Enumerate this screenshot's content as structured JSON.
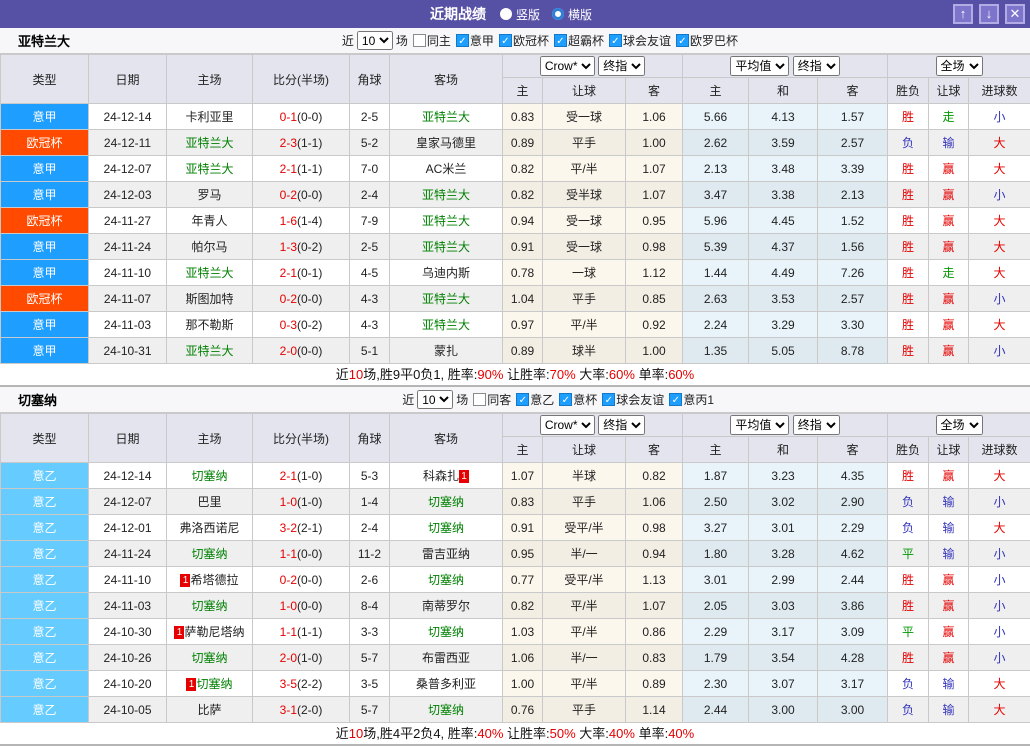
{
  "titlebar": {
    "title": "近期战绩",
    "radio_vertical_label": "竖版",
    "radio_horizontal_label": "横版",
    "up_icon": "↑",
    "down_icon": "↓",
    "close_icon": "✕"
  },
  "filters": {
    "near_label": "近",
    "near_value": "10",
    "games_label": "场"
  },
  "selects": {
    "bookmaker": "Crow*",
    "final_1": "终指",
    "average": "平均值",
    "final_2": "终指",
    "full_match": "全场"
  },
  "columns": {
    "type": "类型",
    "date": "日期",
    "home": "主场",
    "score": "比分(半场)",
    "corner": "角球",
    "away": "客场",
    "odds_home": "主",
    "odds_handicap": "让球",
    "odds_away": "客",
    "avg_home": "主",
    "avg_draw": "和",
    "avg_away": "客",
    "result": "胜负",
    "handicap_result": "让球",
    "goals": "进球数"
  },
  "league_colors": {
    "意甲": "#1e9fff",
    "欧冠杯": "#ff4a00",
    "意乙": "#66ccff"
  },
  "colors": {
    "title_bar": "#5751a5",
    "win_red": "#e60000",
    "lose_blue": "#3333bb",
    "draw_green": "#009900",
    "team_green": "#008000",
    "checkbox_blue": "#1e9fff"
  },
  "sections": [
    {
      "team": "亚特兰大",
      "same_label": "同主",
      "leagues": [
        "意甲",
        "欧冠杯",
        "超霸杯",
        "球会友谊",
        "欧罗巴杯"
      ],
      "rows": [
        {
          "lg": "意甲",
          "dt": "24-12-14",
          "hm": {
            "n": "卡利亚里"
          },
          "s": "0-1",
          "hs": "(0-0)",
          "c": "2-5",
          "aw": {
            "n": "亚特兰大",
            "t": 1
          },
          "o": [
            "0.83",
            "受一球",
            "1.06"
          ],
          "a": [
            "5.66",
            "4.13",
            "1.57"
          ],
          "w": [
            "胜",
            "r"
          ],
          "hr": [
            "走",
            "g"
          ],
          "g": [
            "小",
            "b"
          ]
        },
        {
          "lg": "欧冠杯",
          "dt": "24-12-11",
          "hm": {
            "n": "亚特兰大",
            "t": 1
          },
          "s": "2-3",
          "hs": "(1-1)",
          "c": "5-2",
          "aw": {
            "n": "皇家马德里"
          },
          "o": [
            "0.89",
            "平手",
            "1.00"
          ],
          "a": [
            "2.62",
            "3.59",
            "2.57"
          ],
          "w": [
            "负",
            "b"
          ],
          "hr": [
            "输",
            "b"
          ],
          "g": [
            "大",
            "r"
          ]
        },
        {
          "lg": "意甲",
          "dt": "24-12-07",
          "hm": {
            "n": "亚特兰大",
            "t": 1
          },
          "s": "2-1",
          "hs": "(1-1)",
          "c": "7-0",
          "aw": {
            "n": "AC米兰"
          },
          "o": [
            "0.82",
            "平/半",
            "1.07"
          ],
          "a": [
            "2.13",
            "3.48",
            "3.39"
          ],
          "w": [
            "胜",
            "r"
          ],
          "hr": [
            "赢",
            "r"
          ],
          "g": [
            "大",
            "r"
          ]
        },
        {
          "lg": "意甲",
          "dt": "24-12-03",
          "hm": {
            "n": "罗马"
          },
          "s": "0-2",
          "hs": "(0-0)",
          "c": "2-4",
          "aw": {
            "n": "亚特兰大",
            "t": 1
          },
          "o": [
            "0.82",
            "受半球",
            "1.07"
          ],
          "a": [
            "3.47",
            "3.38",
            "2.13"
          ],
          "w": [
            "胜",
            "r"
          ],
          "hr": [
            "赢",
            "r"
          ],
          "g": [
            "小",
            "b"
          ]
        },
        {
          "lg": "欧冠杯",
          "dt": "24-11-27",
          "hm": {
            "n": "年青人"
          },
          "s": "1-6",
          "hs": "(1-4)",
          "c": "7-9",
          "aw": {
            "n": "亚特兰大",
            "t": 1
          },
          "o": [
            "0.94",
            "受一球",
            "0.95"
          ],
          "a": [
            "5.96",
            "4.45",
            "1.52"
          ],
          "w": [
            "胜",
            "r"
          ],
          "hr": [
            "赢",
            "r"
          ],
          "g": [
            "大",
            "r"
          ]
        },
        {
          "lg": "意甲",
          "dt": "24-11-24",
          "hm": {
            "n": "帕尔马"
          },
          "s": "1-3",
          "hs": "(0-2)",
          "c": "2-5",
          "aw": {
            "n": "亚特兰大",
            "t": 1
          },
          "o": [
            "0.91",
            "受一球",
            "0.98"
          ],
          "a": [
            "5.39",
            "4.37",
            "1.56"
          ],
          "w": [
            "胜",
            "r"
          ],
          "hr": [
            "赢",
            "r"
          ],
          "g": [
            "大",
            "r"
          ]
        },
        {
          "lg": "意甲",
          "dt": "24-11-10",
          "hm": {
            "n": "亚特兰大",
            "t": 1
          },
          "s": "2-1",
          "hs": "(0-1)",
          "c": "4-5",
          "aw": {
            "n": "乌迪内斯"
          },
          "o": [
            "0.78",
            "一球",
            "1.12"
          ],
          "a": [
            "1.44",
            "4.49",
            "7.26"
          ],
          "w": [
            "胜",
            "r"
          ],
          "hr": [
            "走",
            "g"
          ],
          "g": [
            "大",
            "r"
          ]
        },
        {
          "lg": "欧冠杯",
          "dt": "24-11-07",
          "hm": {
            "n": "斯图加特"
          },
          "s": "0-2",
          "hs": "(0-0)",
          "c": "4-3",
          "aw": {
            "n": "亚特兰大",
            "t": 1
          },
          "o": [
            "1.04",
            "平手",
            "0.85"
          ],
          "a": [
            "2.63",
            "3.53",
            "2.57"
          ],
          "w": [
            "胜",
            "r"
          ],
          "hr": [
            "赢",
            "r"
          ],
          "g": [
            "小",
            "b"
          ]
        },
        {
          "lg": "意甲",
          "dt": "24-11-03",
          "hm": {
            "n": "那不勒斯"
          },
          "s": "0-3",
          "hs": "(0-2)",
          "c": "4-3",
          "aw": {
            "n": "亚特兰大",
            "t": 1
          },
          "o": [
            "0.97",
            "平/半",
            "0.92"
          ],
          "a": [
            "2.24",
            "3.29",
            "3.30"
          ],
          "w": [
            "胜",
            "r"
          ],
          "hr": [
            "赢",
            "r"
          ],
          "g": [
            "大",
            "r"
          ]
        },
        {
          "lg": "意甲",
          "dt": "24-10-31",
          "hm": {
            "n": "亚特兰大",
            "t": 1
          },
          "s": "2-0",
          "hs": "(0-0)",
          "c": "5-1",
          "aw": {
            "n": "蒙扎"
          },
          "o": [
            "0.89",
            "球半",
            "1.00"
          ],
          "a": [
            "1.35",
            "5.05",
            "8.78"
          ],
          "w": [
            "胜",
            "r"
          ],
          "hr": [
            "赢",
            "r"
          ],
          "g": [
            "小",
            "b"
          ]
        }
      ],
      "summary": [
        "近",
        "10",
        "场,胜9平0负1, 胜率:",
        "90%",
        " 让胜率:",
        "70%",
        " 大率:",
        "60%",
        " 单率:",
        "60%"
      ]
    },
    {
      "team": "切塞纳",
      "same_label": "同客",
      "leagues": [
        "意乙",
        "意杯",
        "球会友谊",
        "意丙1"
      ],
      "rows": [
        {
          "lg": "意乙",
          "dt": "24-12-14",
          "hm": {
            "n": "切塞纳",
            "t": 1
          },
          "s": "2-1",
          "hs": "(1-0)",
          "c": "5-3",
          "aw": {
            "n": "科森扎",
            "b": "post"
          },
          "o": [
            "1.07",
            "半球",
            "0.82"
          ],
          "a": [
            "1.87",
            "3.23",
            "4.35"
          ],
          "w": [
            "胜",
            "r"
          ],
          "hr": [
            "赢",
            "r"
          ],
          "g": [
            "大",
            "r"
          ]
        },
        {
          "lg": "意乙",
          "dt": "24-12-07",
          "hm": {
            "n": "巴里"
          },
          "s": "1-0",
          "hs": "(1-0)",
          "c": "1-4",
          "aw": {
            "n": "切塞纳",
            "t": 1
          },
          "o": [
            "0.83",
            "平手",
            "1.06"
          ],
          "a": [
            "2.50",
            "3.02",
            "2.90"
          ],
          "w": [
            "负",
            "b"
          ],
          "hr": [
            "输",
            "b"
          ],
          "g": [
            "小",
            "b"
          ]
        },
        {
          "lg": "意乙",
          "dt": "24-12-01",
          "hm": {
            "n": "弗洛西诺尼"
          },
          "s": "3-2",
          "hs": "(2-1)",
          "c": "2-4",
          "aw": {
            "n": "切塞纳",
            "t": 1
          },
          "o": [
            "0.91",
            "受平/半",
            "0.98"
          ],
          "a": [
            "3.27",
            "3.01",
            "2.29"
          ],
          "w": [
            "负",
            "b"
          ],
          "hr": [
            "输",
            "b"
          ],
          "g": [
            "大",
            "r"
          ]
        },
        {
          "lg": "意乙",
          "dt": "24-11-24",
          "hm": {
            "n": "切塞纳",
            "t": 1
          },
          "s": "1-1",
          "hs": "(0-0)",
          "c": "11-2",
          "aw": {
            "n": "雷吉亚纳"
          },
          "o": [
            "0.95",
            "半/一",
            "0.94"
          ],
          "a": [
            "1.80",
            "3.28",
            "4.62"
          ],
          "w": [
            "平",
            "g"
          ],
          "hr": [
            "输",
            "b"
          ],
          "g": [
            "小",
            "b"
          ]
        },
        {
          "lg": "意乙",
          "dt": "24-11-10",
          "hm": {
            "n": "希塔德拉",
            "b": "pre"
          },
          "s": "0-2",
          "hs": "(0-0)",
          "c": "2-6",
          "aw": {
            "n": "切塞纳",
            "t": 1
          },
          "o": [
            "0.77",
            "受平/半",
            "1.13"
          ],
          "a": [
            "3.01",
            "2.99",
            "2.44"
          ],
          "w": [
            "胜",
            "r"
          ],
          "hr": [
            "赢",
            "r"
          ],
          "g": [
            "小",
            "b"
          ]
        },
        {
          "lg": "意乙",
          "dt": "24-11-03",
          "hm": {
            "n": "切塞纳",
            "t": 1
          },
          "s": "1-0",
          "hs": "(0-0)",
          "c": "8-4",
          "aw": {
            "n": "南蒂罗尔"
          },
          "o": [
            "0.82",
            "平/半",
            "1.07"
          ],
          "a": [
            "2.05",
            "3.03",
            "3.86"
          ],
          "w": [
            "胜",
            "r"
          ],
          "hr": [
            "赢",
            "r"
          ],
          "g": [
            "小",
            "b"
          ]
        },
        {
          "lg": "意乙",
          "dt": "24-10-30",
          "hm": {
            "n": "萨勒尼塔纳",
            "b": "pre"
          },
          "s": "1-1",
          "hs": "(1-1)",
          "c": "3-3",
          "aw": {
            "n": "切塞纳",
            "t": 1
          },
          "o": [
            "1.03",
            "平/半",
            "0.86"
          ],
          "a": [
            "2.29",
            "3.17",
            "3.09"
          ],
          "w": [
            "平",
            "g"
          ],
          "hr": [
            "赢",
            "r"
          ],
          "g": [
            "小",
            "b"
          ]
        },
        {
          "lg": "意乙",
          "dt": "24-10-26",
          "hm": {
            "n": "切塞纳",
            "t": 1
          },
          "s": "2-0",
          "hs": "(1-0)",
          "c": "5-7",
          "aw": {
            "n": "布雷西亚"
          },
          "o": [
            "1.06",
            "半/一",
            "0.83"
          ],
          "a": [
            "1.79",
            "3.54",
            "4.28"
          ],
          "w": [
            "胜",
            "r"
          ],
          "hr": [
            "赢",
            "r"
          ],
          "g": [
            "小",
            "b"
          ]
        },
        {
          "lg": "意乙",
          "dt": "24-10-20",
          "hm": {
            "n": "切塞纳",
            "t": 1,
            "b": "pre"
          },
          "s": "3-5",
          "hs": "(2-2)",
          "c": "3-5",
          "aw": {
            "n": "桑普多利亚"
          },
          "o": [
            "1.00",
            "平/半",
            "0.89"
          ],
          "a": [
            "2.30",
            "3.07",
            "3.17"
          ],
          "w": [
            "负",
            "b"
          ],
          "hr": [
            "输",
            "b"
          ],
          "g": [
            "大",
            "r"
          ]
        },
        {
          "lg": "意乙",
          "dt": "24-10-05",
          "hm": {
            "n": "比萨"
          },
          "s": "3-1",
          "hs": "(2-0)",
          "c": "5-7",
          "aw": {
            "n": "切塞纳",
            "t": 1
          },
          "o": [
            "0.76",
            "平手",
            "1.14"
          ],
          "a": [
            "2.44",
            "3.00",
            "3.00"
          ],
          "w": [
            "负",
            "b"
          ],
          "hr": [
            "输",
            "b"
          ],
          "g": [
            "大",
            "r"
          ]
        }
      ],
      "summary": [
        "近",
        "10",
        "场,胜4平2负4, 胜率:",
        "40%",
        " 让胜率:",
        "50%",
        " 大率:",
        "40%",
        " 单率:",
        "40%"
      ]
    }
  ]
}
